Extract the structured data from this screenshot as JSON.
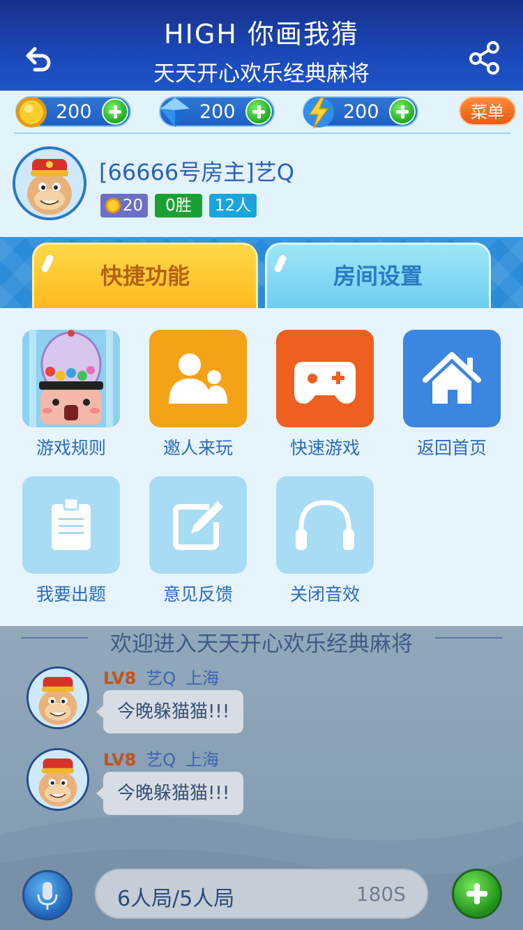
{
  "header": {
    "title": "HIGH 你画我猜",
    "subtitle": "天天开心欢乐经典麻将",
    "back_icon": "back-arrow-icon",
    "share_icon": "share-icon"
  },
  "resources": {
    "coins": "200",
    "diamonds": "200",
    "energy": "200",
    "menu_label": "菜单"
  },
  "profile": {
    "name": "[66666号房主]艺Q",
    "coin_badge": "20",
    "wins_badge": "0胜",
    "people_badge": "12人"
  },
  "tabs": {
    "quick": "快捷功能",
    "room": "房间设置"
  },
  "functions": {
    "rules": "游戏规则",
    "invite": "邀人来玩",
    "quick_game": "快速游戏",
    "home": "返回首页",
    "question": "我要出题",
    "feedback": "意见反馈",
    "sound": "关闭音效"
  },
  "chat": {
    "welcome": "欢迎进入天天开心欢乐经典麻将",
    "messages": [
      {
        "level": "LV8",
        "name": "艺Q",
        "location": "上海",
        "text": "今晚躲猫猫!!!"
      },
      {
        "level": "LV8",
        "name": "艺Q",
        "location": "上海",
        "text": "今晚躲猫猫!!!"
      }
    ]
  },
  "bottom": {
    "mode": "6人局/5人局",
    "time": "180S"
  },
  "colors": {
    "header": "#1b48b8",
    "tab_active": "#ffc62e",
    "tab_inactive": "#7dd5f2",
    "invite_tile": "#f5a316",
    "quick_tile": "#ef5f22",
    "home_tile": "#3a86e0",
    "light_tile": "#a7dcf4"
  }
}
